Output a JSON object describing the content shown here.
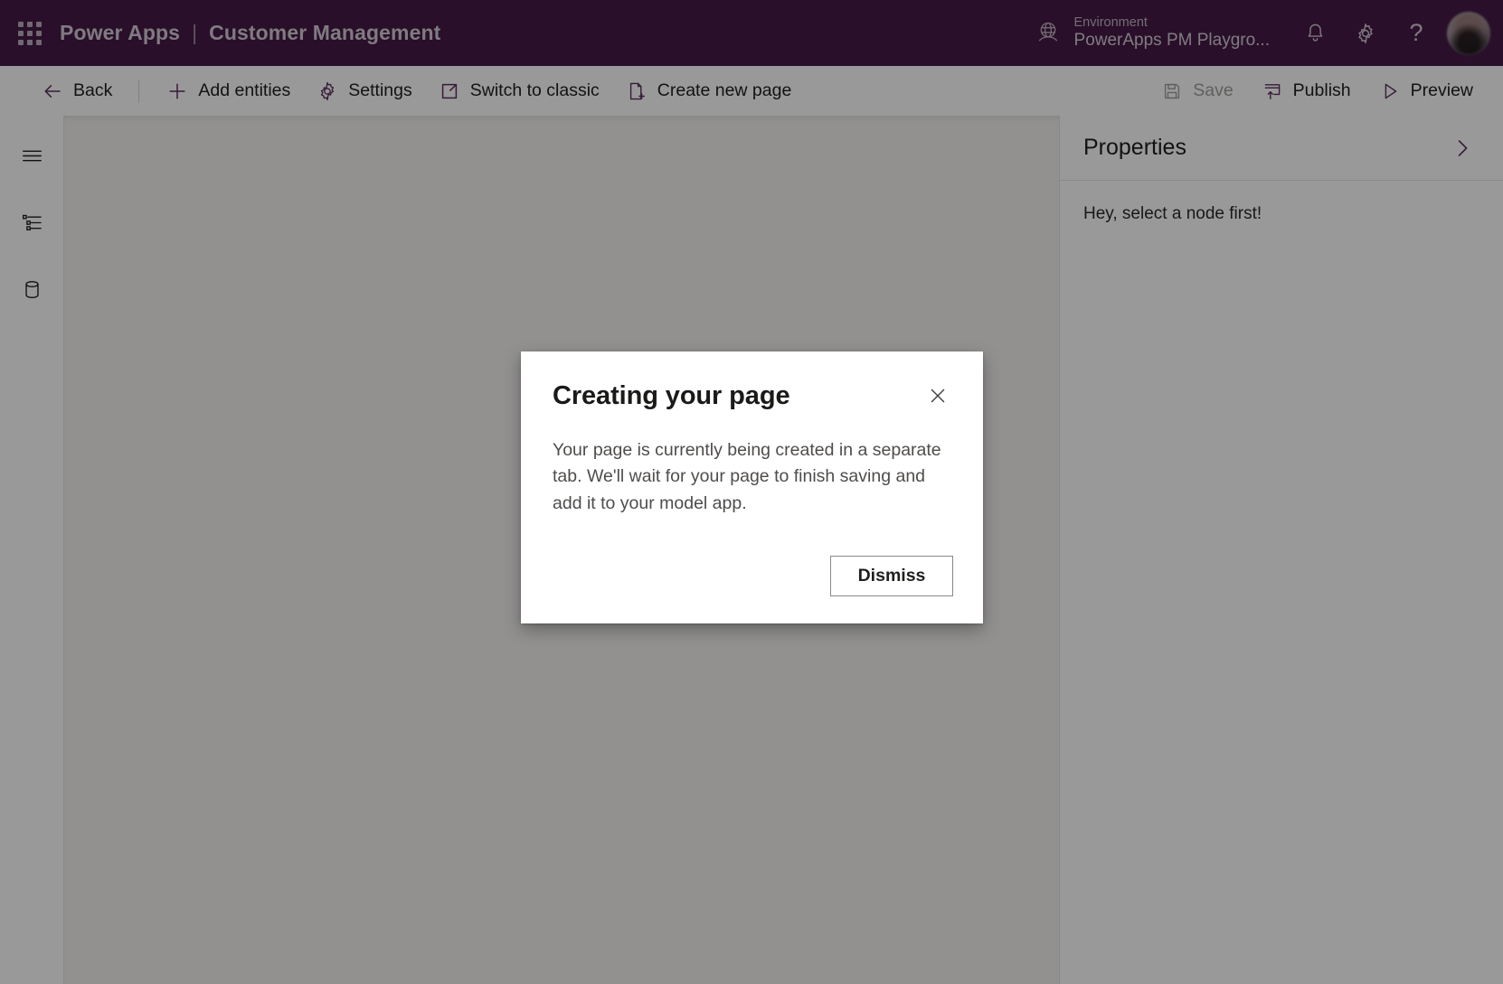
{
  "header": {
    "waffle_icon": "app-launcher-waffle-icon",
    "product_name": "Power Apps",
    "separator": "|",
    "app_name": "Customer Management",
    "environment": {
      "icon": "globe-environment-icon",
      "label": "Environment",
      "value": "PowerApps PM Playgro..."
    },
    "notifications_icon": "bell-icon",
    "settings_icon": "gear-icon",
    "help_icon": "question-mark-icon",
    "help_glyph": "?",
    "avatar": "user-avatar"
  },
  "commandbar": {
    "back": {
      "label": "Back",
      "icon": "arrow-left-icon"
    },
    "add_entities": {
      "label": "Add entities",
      "icon": "plus-icon"
    },
    "settings": {
      "label": "Settings",
      "icon": "gear-icon"
    },
    "switch_to_classic": {
      "label": "Switch to classic",
      "icon": "open-in-new-window-icon"
    },
    "create_new_page": {
      "label": "Create new page",
      "icon": "page-add-icon"
    },
    "save": {
      "label": "Save",
      "icon": "floppy-disk-icon",
      "disabled": true
    },
    "publish": {
      "label": "Publish",
      "icon": "publish-upload-icon"
    },
    "preview": {
      "label": "Preview",
      "icon": "play-triangle-icon"
    }
  },
  "rail": {
    "items": [
      {
        "name": "menu-icon",
        "title": "Menu"
      },
      {
        "name": "tree-view-icon",
        "title": "Tree view"
      },
      {
        "name": "database-icon",
        "title": "Data"
      }
    ]
  },
  "properties": {
    "title": "Properties",
    "collapse_icon": "chevron-right-icon",
    "empty_message": "Hey, select a node first!"
  },
  "dialog": {
    "title": "Creating your page",
    "close_icon": "close-x-icon",
    "body": "Your page is currently being created in a separate tab. We'll wait for your page to finish saving and add it to your model app.",
    "dismiss_label": "Dismiss"
  },
  "colors": {
    "brand_purple": "#451a47",
    "accent_purple": "#5c2d5e",
    "canvas_grey": "#f3f2f1",
    "disabled_grey": "#a19f9d",
    "scrim": "rgba(0,0,0,0.40)"
  }
}
